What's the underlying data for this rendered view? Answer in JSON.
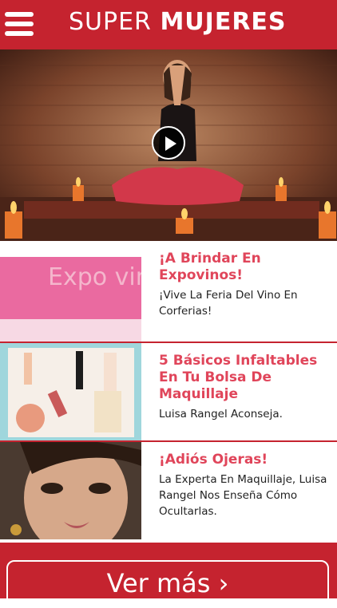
{
  "header": {
    "brand_light": "SUPER",
    "brand_bold": "MUJERES"
  },
  "hero": {
    "play_icon": "play-icon"
  },
  "articles": [
    {
      "title": "¡A Brindar En Expovinos!",
      "summary": "¡Vive La Feria Del Vino En Corferias!",
      "thumb_text": "Expo vinos"
    },
    {
      "title": "5 Básicos Infaltables En Tu Bolsa De Maquillaje",
      "summary": "Luisa Rangel Aconseja."
    },
    {
      "title": "¡Adiós Ojeras!",
      "summary": "La Experta En Maquillaje, Luisa Rangel Nos Enseña Cómo Ocultarlas."
    }
  ],
  "footer": {
    "ver_mas": "Ver más ›"
  },
  "colors": {
    "brand": "#c5232f",
    "title": "#e0455a"
  }
}
